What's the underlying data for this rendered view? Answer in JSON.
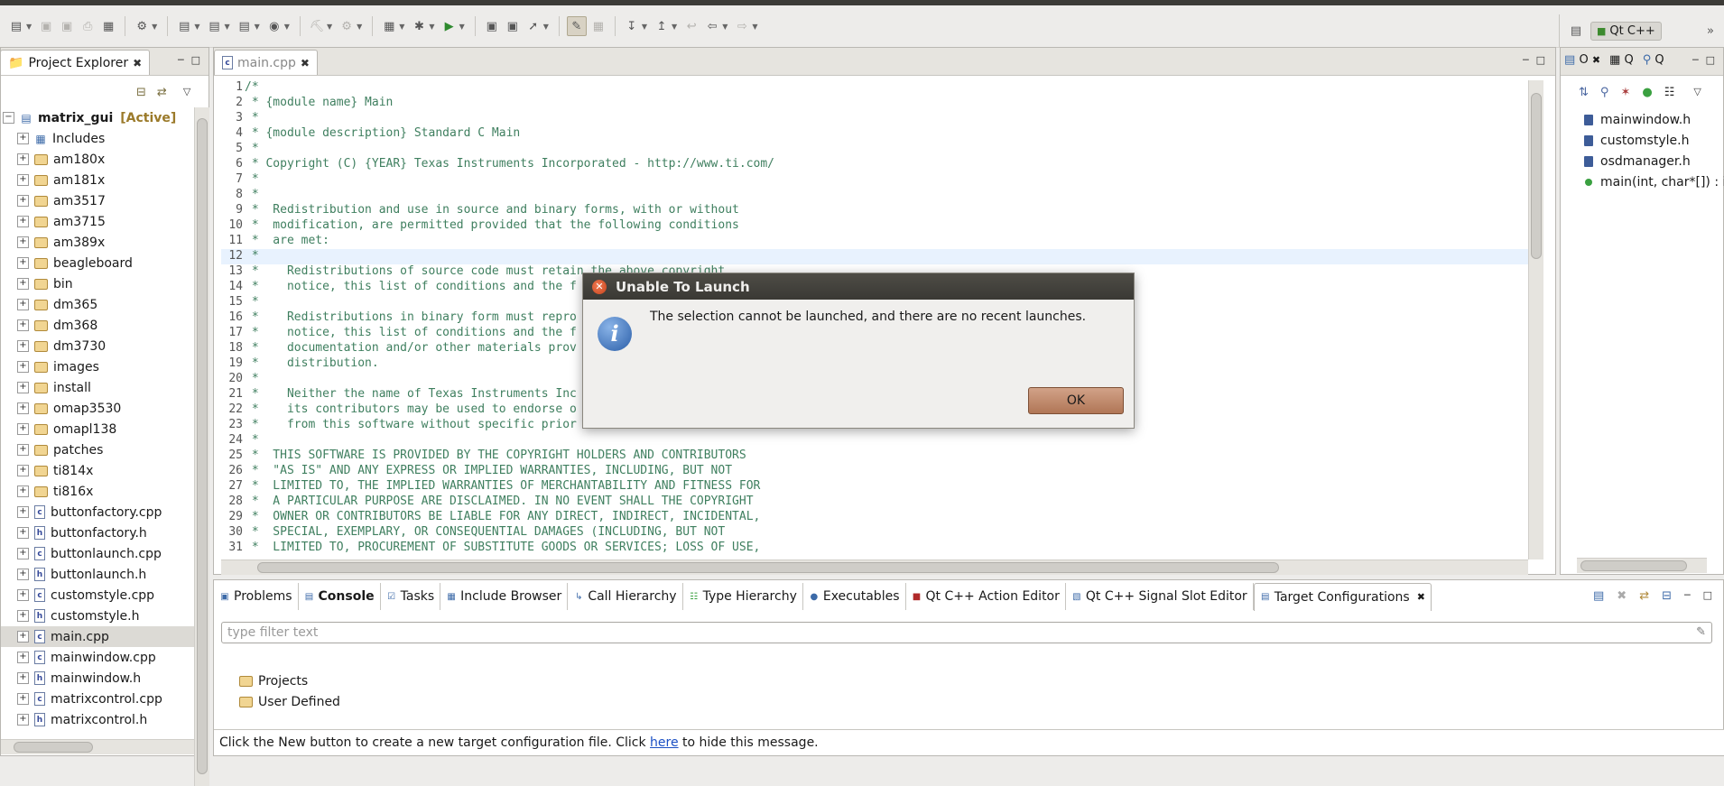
{
  "perspective": {
    "label": "Qt C++"
  },
  "explorer": {
    "tab_label": "Project Explorer",
    "root": {
      "name": "matrix_gui",
      "status": "[Active]"
    },
    "items": [
      {
        "label": "Includes",
        "icon": "includes-icon"
      },
      {
        "label": "am180x",
        "icon": "folder-icon"
      },
      {
        "label": "am181x",
        "icon": "folder-icon"
      },
      {
        "label": "am3517",
        "icon": "folder-icon"
      },
      {
        "label": "am3715",
        "icon": "folder-icon"
      },
      {
        "label": "am389x",
        "icon": "folder-icon"
      },
      {
        "label": "beagleboard",
        "icon": "folder-icon"
      },
      {
        "label": "bin",
        "icon": "folder-icon"
      },
      {
        "label": "dm365",
        "icon": "folder-icon"
      },
      {
        "label": "dm368",
        "icon": "folder-icon"
      },
      {
        "label": "dm3730",
        "icon": "folder-icon"
      },
      {
        "label": "images",
        "icon": "folder-icon"
      },
      {
        "label": "install",
        "icon": "folder-icon"
      },
      {
        "label": "omap3530",
        "icon": "folder-icon"
      },
      {
        "label": "omapl138",
        "icon": "folder-icon"
      },
      {
        "label": "patches",
        "icon": "folder-icon"
      },
      {
        "label": "ti814x",
        "icon": "folder-icon"
      },
      {
        "label": "ti816x",
        "icon": "folder-icon"
      },
      {
        "label": "buttonfactory.cpp",
        "icon": "cpp-file-icon"
      },
      {
        "label": "buttonfactory.h",
        "icon": "header-file-icon"
      },
      {
        "label": "buttonlaunch.cpp",
        "icon": "cpp-file-icon"
      },
      {
        "label": "buttonlaunch.h",
        "icon": "header-file-icon"
      },
      {
        "label": "customstyle.cpp",
        "icon": "cpp-file-icon"
      },
      {
        "label": "customstyle.h",
        "icon": "header-file-icon"
      },
      {
        "label": "main.cpp",
        "icon": "cpp-file-icon",
        "selected": true
      },
      {
        "label": "mainwindow.cpp",
        "icon": "cpp-file-icon"
      },
      {
        "label": "mainwindow.h",
        "icon": "header-file-icon"
      },
      {
        "label": "matrixcontrol.cpp",
        "icon": "cpp-file-icon"
      },
      {
        "label": "matrixcontrol.h",
        "icon": "header-file-icon"
      }
    ]
  },
  "editor": {
    "tab_label": "main.cpp",
    "highlight_line": 12,
    "lines": [
      "/*",
      " * {module name} Main",
      " *",
      " * {module description} Standard C Main",
      " *",
      " * Copyright (C) {YEAR} Texas Instruments Incorporated - http://www.ti.com/",
      " *",
      " *",
      " *  Redistribution and use in source and binary forms, with or without",
      " *  modification, are permitted provided that the following conditions",
      " *  are met:",
      " *",
      " *    Redistributions of source code must retain the above copyright",
      " *    notice, this list of conditions and the f",
      " *",
      " *    Redistributions in binary form must repro",
      " *    notice, this list of conditions and the f",
      " *    documentation and/or other materials prov",
      " *    distribution.",
      " *",
      " *    Neither the name of Texas Instruments Inc",
      " *    its contributors may be used to endorse o",
      " *    from this software without specific prior",
      " *",
      " *  THIS SOFTWARE IS PROVIDED BY THE COPYRIGHT HOLDERS AND CONTRIBUTORS",
      " *  \"AS IS\" AND ANY EXPRESS OR IMPLIED WARRANTIES, INCLUDING, BUT NOT",
      " *  LIMITED TO, THE IMPLIED WARRANTIES OF MERCHANTABILITY AND FITNESS FOR",
      " *  A PARTICULAR PURPOSE ARE DISCLAIMED. IN NO EVENT SHALL THE COPYRIGHT",
      " *  OWNER OR CONTRIBUTORS BE LIABLE FOR ANY DIRECT, INDIRECT, INCIDENTAL,",
      " *  SPECIAL, EXEMPLARY, OR CONSEQUENTIAL DAMAGES (INCLUDING, BUT NOT",
      " *  LIMITED TO, PROCUREMENT OF SUBSTITUTE GOODS OR SERVICES; LOSS OF USE,"
    ]
  },
  "outline": {
    "tabs": [
      "O",
      "Q",
      "Q"
    ],
    "items": [
      {
        "label": "mainwindow.h",
        "kind": "include"
      },
      {
        "label": "customstyle.h",
        "kind": "include"
      },
      {
        "label": "osdmanager.h",
        "kind": "include"
      },
      {
        "label": "main(int, char*[]) : i",
        "kind": "function"
      }
    ]
  },
  "bottom": {
    "tabs": [
      {
        "label": "Problems",
        "icon": "problems-icon"
      },
      {
        "label": "Console",
        "icon": "console-icon",
        "bold": true
      },
      {
        "label": "Tasks",
        "icon": "tasks-icon"
      },
      {
        "label": "Include Browser",
        "icon": "include-browser-icon"
      },
      {
        "label": "Call Hierarchy",
        "icon": "call-hierarchy-icon"
      },
      {
        "label": "Type Hierarchy",
        "icon": "type-hierarchy-icon"
      },
      {
        "label": "Executables",
        "icon": "executables-icon"
      },
      {
        "label": "Qt C++ Action Editor",
        "icon": "action-editor-icon"
      },
      {
        "label": "Qt C++ Signal Slot Editor",
        "icon": "signal-slot-icon"
      },
      {
        "label": "Target Configurations",
        "icon": "target-config-icon",
        "active": true
      }
    ],
    "filter_placeholder": "type filter text",
    "tree": [
      {
        "label": "Projects"
      },
      {
        "label": "User Defined"
      }
    ],
    "status_prefix": "Click the New button to create a new target configuration file. Click ",
    "status_link": "here",
    "status_suffix": " to hide this message."
  },
  "dialog": {
    "title": "Unable To Launch",
    "message": "The selection cannot be launched, and there are no recent launches.",
    "ok_label": "OK"
  }
}
